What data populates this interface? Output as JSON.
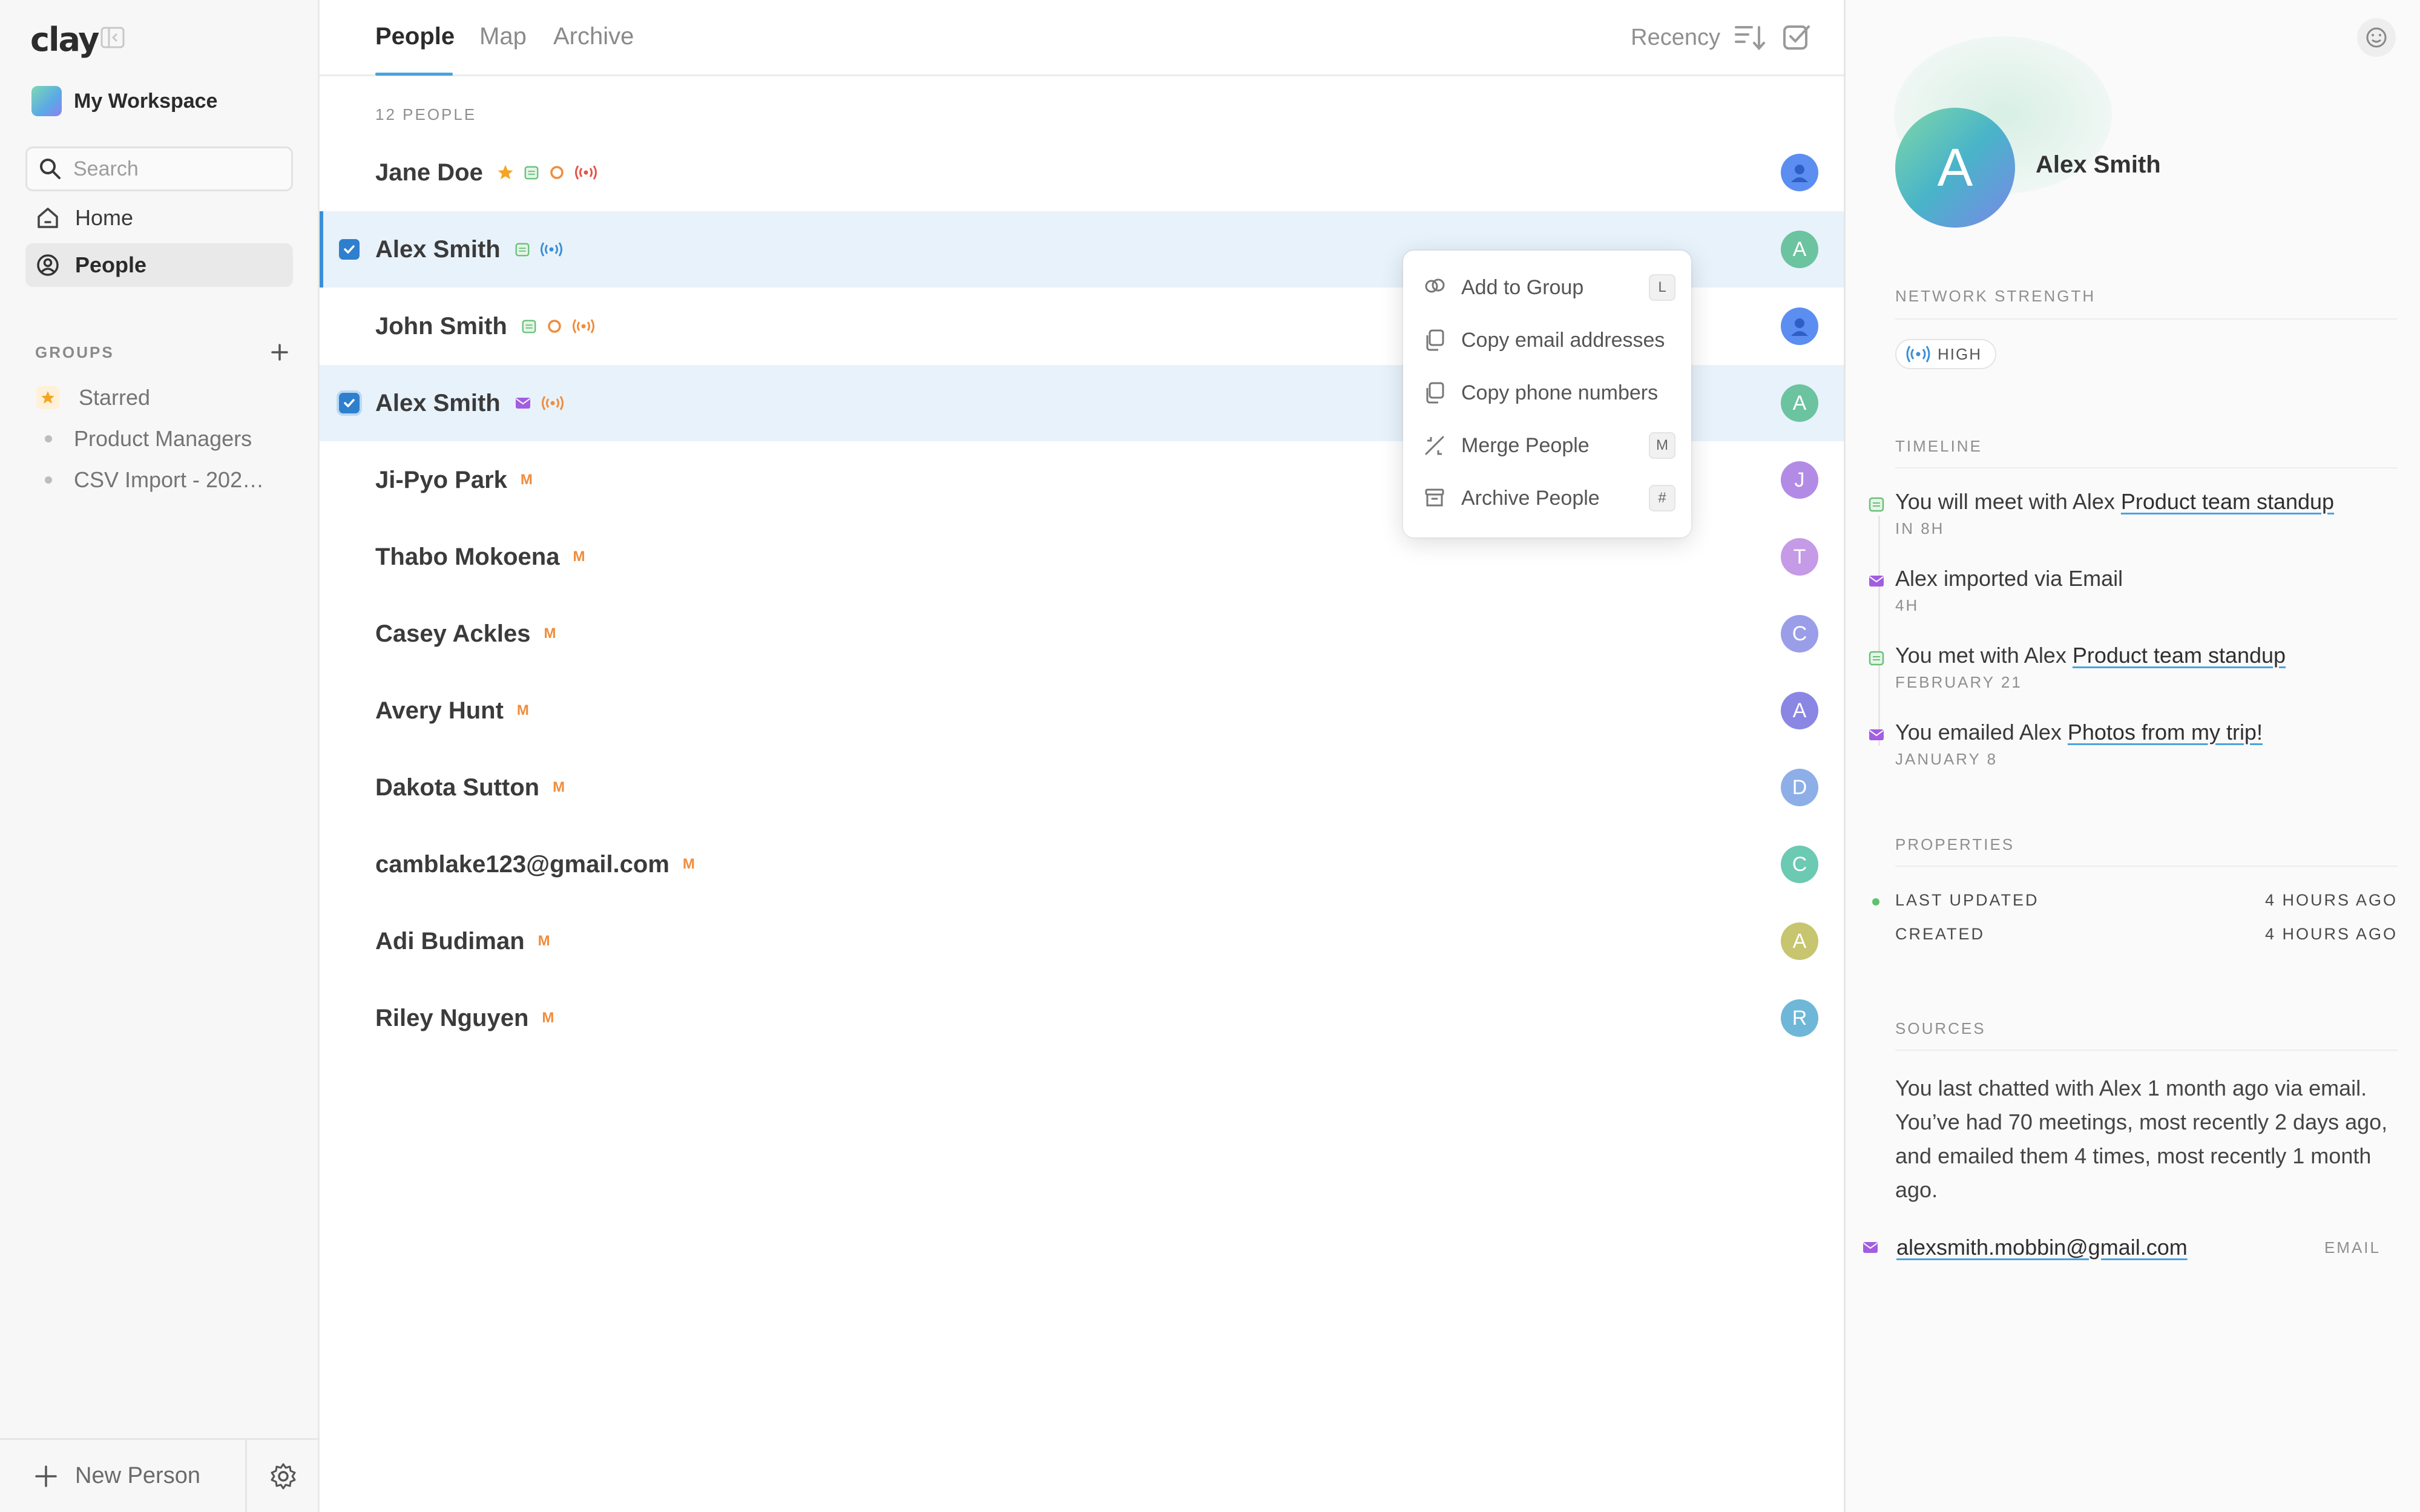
{
  "sidebar": {
    "logo": "clay",
    "workspace": "My Workspace",
    "search_placeholder": "Search",
    "nav": [
      {
        "label": "Home",
        "icon": "home-icon"
      },
      {
        "label": "People",
        "icon": "person-circle-icon"
      }
    ],
    "groups_label": "GROUPS",
    "groups": [
      {
        "label": "Starred",
        "icon": "star-icon"
      },
      {
        "label": "Product Managers",
        "icon": "dot"
      },
      {
        "label": "CSV Import - 202…",
        "icon": "dot"
      }
    ],
    "new_person": "New Person"
  },
  "main": {
    "tabs": [
      {
        "label": "People",
        "active": true
      },
      {
        "label": "Map",
        "active": false
      },
      {
        "label": "Archive",
        "active": false
      }
    ],
    "sort_label": "Recency",
    "count_label": "12 PEOPLE",
    "people": [
      {
        "name": "Jane Doe",
        "badges": [
          "star",
          "calendar",
          "ring",
          "signal-red"
        ],
        "avatar": "",
        "avatar_color": "#5b8ef0",
        "selected": false
      },
      {
        "name": "Alex Smith",
        "badges": [
          "calendar",
          "signal-blue"
        ],
        "avatar": "A",
        "avatar_color": "#6cc3a0",
        "selected": true
      },
      {
        "name": "John Smith",
        "badges": [
          "calendar",
          "ring",
          "signal-orange"
        ],
        "avatar": "",
        "avatar_color": "#5b8ef0",
        "selected": false
      },
      {
        "name": "Alex Smith",
        "badges": [
          "mail",
          "signal-orange"
        ],
        "avatar": "A",
        "avatar_color": "#6cc3a0",
        "selected": true
      },
      {
        "name": "Ji-Pyo Park",
        "badges": [
          "M"
        ],
        "avatar": "J",
        "avatar_color": "#b28be6",
        "selected": false
      },
      {
        "name": "Thabo Mokoena",
        "badges": [
          "M"
        ],
        "avatar": "T",
        "avatar_color": "#c59ae6",
        "selected": false
      },
      {
        "name": "Casey Ackles",
        "badges": [
          "M"
        ],
        "avatar": "C",
        "avatar_color": "#9a9ee8",
        "selected": false
      },
      {
        "name": "Avery Hunt",
        "badges": [
          "M"
        ],
        "avatar": "A",
        "avatar_color": "#8a86e4",
        "selected": false
      },
      {
        "name": "Dakota Sutton",
        "badges": [
          "M"
        ],
        "avatar": "D",
        "avatar_color": "#8eaee8",
        "selected": false
      },
      {
        "name": "camblake123@gmail.com",
        "badges": [
          "M"
        ],
        "avatar": "C",
        "avatar_color": "#6cc9b2",
        "selected": false
      },
      {
        "name": "Adi Budiman",
        "badges": [
          "M"
        ],
        "avatar": "A",
        "avatar_color": "#c7c56f",
        "selected": false
      },
      {
        "name": "Riley Nguyen",
        "badges": [
          "M"
        ],
        "avatar": "R",
        "avatar_color": "#6fb7d8",
        "selected": false
      }
    ]
  },
  "menu": {
    "items": [
      {
        "label": "Add to Group",
        "icon": "group-icon",
        "shortcut": "L"
      },
      {
        "label": "Copy email addresses",
        "icon": "copy-icon",
        "shortcut": ""
      },
      {
        "label": "Copy phone numbers",
        "icon": "copy-icon",
        "shortcut": ""
      },
      {
        "label": "Merge People",
        "icon": "merge-icon",
        "shortcut": "M"
      },
      {
        "label": "Archive People",
        "icon": "archive-icon",
        "shortcut": "#"
      }
    ]
  },
  "panel": {
    "avatar_letter": "A",
    "name": "Alex Smith",
    "network_label": "NETWORK STRENGTH",
    "strength": "HIGH",
    "timeline_label": "TIMELINE",
    "timeline": [
      {
        "icon": "calendar",
        "text": "You will meet with Alex ",
        "link": "Product team standup",
        "sub": "IN 8H"
      },
      {
        "icon": "mail",
        "text": "Alex imported via Email",
        "link": "",
        "sub": "4H"
      },
      {
        "icon": "calendar",
        "text": "You met with Alex ",
        "link": "Product team standup",
        "sub": "FEBRUARY 21"
      },
      {
        "icon": "mail",
        "text": "You emailed Alex ",
        "link": "Photos from my trip!",
        "sub": "JANUARY 8"
      }
    ],
    "properties_label": "PROPERTIES",
    "properties": [
      {
        "key": "LAST UPDATED",
        "value": "4 HOURS AGO"
      },
      {
        "key": "CREATED",
        "value": "4 HOURS AGO"
      }
    ],
    "sources_label": "SOURCES",
    "sources_text": "You last chatted with Alex 1 month ago via email. You’ve had 70 meetings, most recently 2 days ago, and emailed them 4 times, most recently 1 month ago.",
    "email": "alexsmith.mobbin@gmail.com",
    "email_type": "EMAIL"
  },
  "colors": {
    "accent": "#4aa3df",
    "selected_row": "#e8f2fb",
    "check": "#2f7fcf",
    "badge_orange": "#f08c3c",
    "badge_green": "#6cbf7a",
    "badge_purple": "#a25ee0"
  }
}
